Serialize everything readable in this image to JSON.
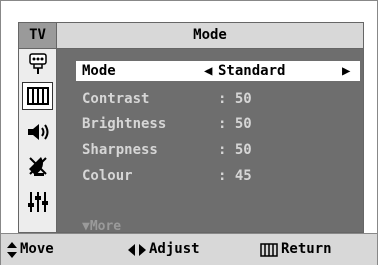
{
  "header": {
    "tv_tag": "TV",
    "title": "Mode"
  },
  "sidebar": {
    "items": [
      {
        "icon": "input-icon"
      },
      {
        "icon": "picture-icon",
        "active": true
      },
      {
        "icon": "sound-icon"
      },
      {
        "icon": "channel-antenna-icon"
      },
      {
        "icon": "setup-icon"
      }
    ]
  },
  "menu": {
    "selected": {
      "label": "Mode",
      "value": "Standard"
    },
    "items": [
      {
        "label": "Contrast",
        "value": ": 50"
      },
      {
        "label": "Brightness",
        "value": ": 50"
      },
      {
        "label": "Sharpness",
        "value": ": 50"
      },
      {
        "label": "Colour",
        "value": ": 45"
      }
    ],
    "more": "More"
  },
  "footer": {
    "move": "Move",
    "adjust": "Adjust",
    "return": "Return"
  },
  "colors": {
    "panel_bg": "#6e6e6e",
    "title_bg": "#d8d8d8",
    "highlight": "#ffffff"
  }
}
